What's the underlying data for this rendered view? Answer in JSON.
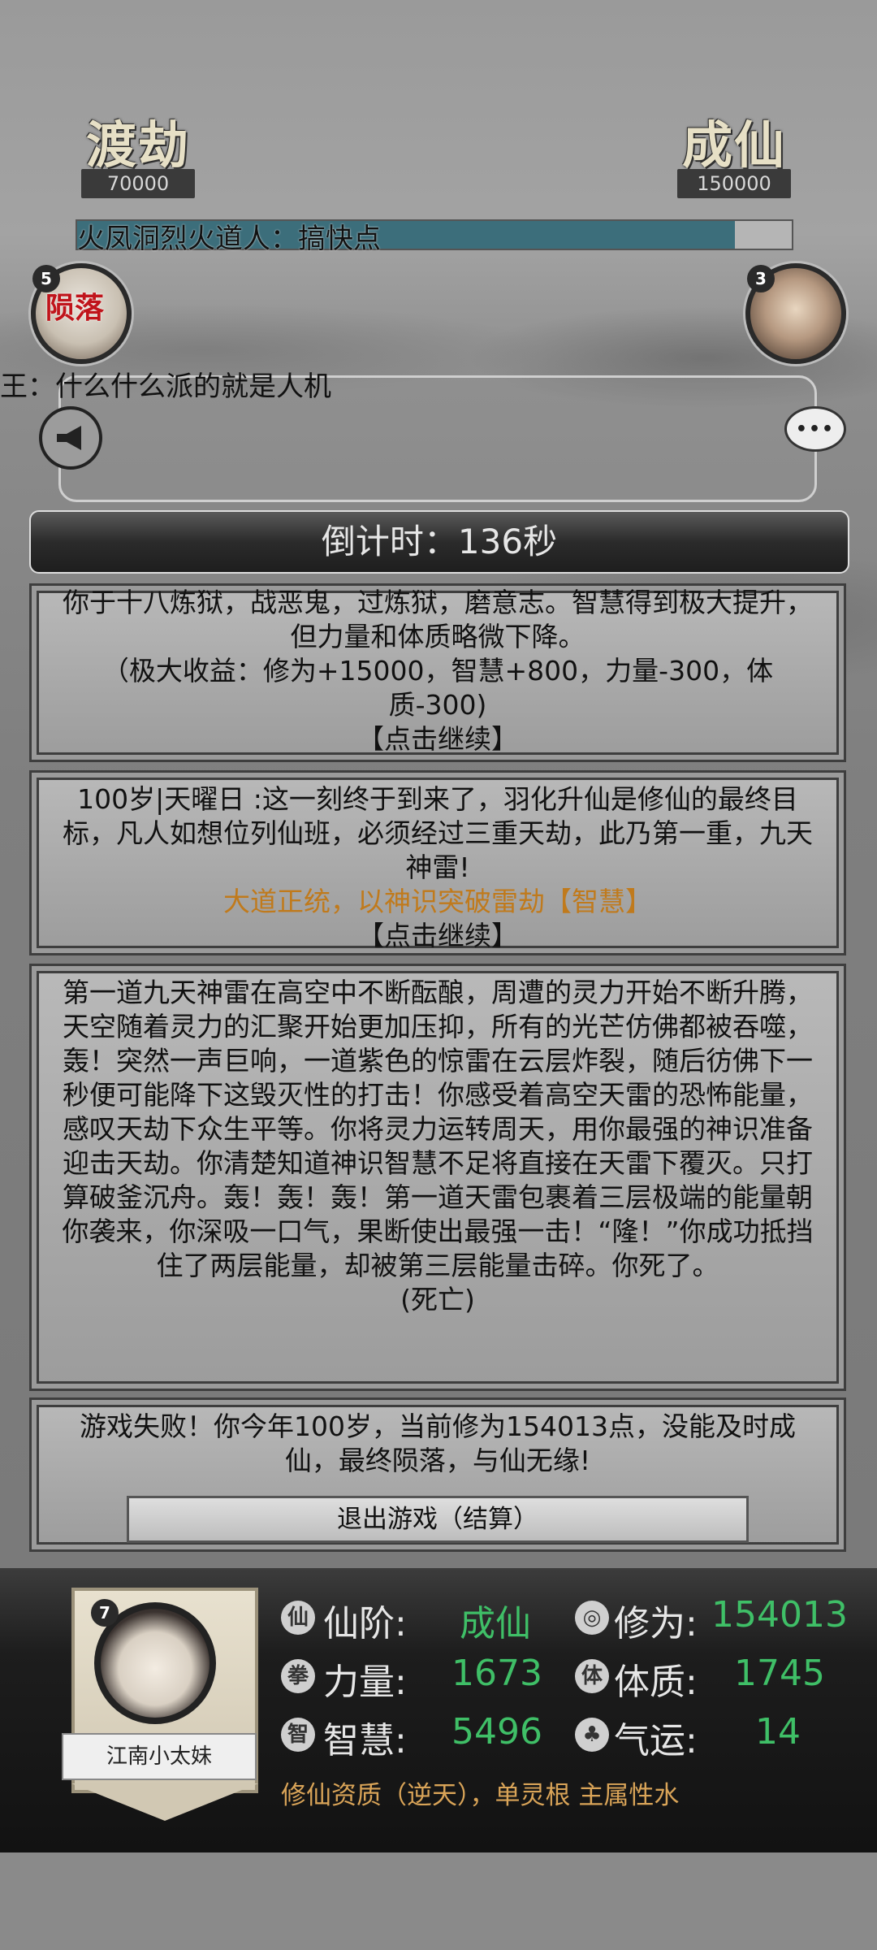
{
  "stages": {
    "left": {
      "name": "渡劫",
      "value": "70000"
    },
    "right": {
      "name": "成仙",
      "value": "150000"
    }
  },
  "progress": {
    "label": "火凤洞烈火道人：搞快点",
    "fraction": 0.92
  },
  "players": {
    "left": {
      "badge": "5",
      "status": "陨落"
    },
    "right": {
      "badge": "3"
    }
  },
  "chat": {
    "line": "王：什么什么派的就是人机"
  },
  "timer": {
    "text": "倒计时：136秒"
  },
  "cards": [
    {
      "lines": [
        "你于十八炼狱，战恶鬼，过炼狱，磨意志。智慧得到极大提升，但力量和体质略微下降。",
        "（极大收益：修为+15000，智慧+800，力量-300，体质-300)"
      ],
      "continue": "【点击继续】"
    },
    {
      "lines": [
        "100岁|天曜日 :这一刻终于到来了，羽化升仙是修仙的最终目标，凡人如想位列仙班，必须经过三重天劫，此乃第一重，九天神雷!"
      ],
      "highlight": "大道正统，以神识突破雷劫【智慧】",
      "continue": "【点击继续】"
    },
    {
      "lines": [
        "第一道九天神雷在高空中不断酝酿，周遭的灵力开始不断升腾，天空随着灵力的汇聚开始更加压抑，所有的光芒仿佛都被吞噬，轰！突然一声巨响，一道紫色的惊雷在云层炸裂，随后彷佛下一秒便可能降下这毁灭性的打击！你感受着高空天雷的恐怖能量，感叹天劫下众生平等。你将灵力运转周天，用你最强的神识准备迎击天劫。你清楚知道神识智慧不足将直接在天雷下覆灭。只打算破釜沉舟。轰！轰！轰！第一道天雷包裹着三层极端的能量朝你袭来，你深吸一口气，果断使出最强一击！“隆！”你成功抵挡住了两层能量，却被第三层能量击碎。你死了。"
      ],
      "result": "(死亡)"
    },
    {
      "lines": [
        "游戏失败！你今年100岁，当前修为154013点，没能及时成仙，最终陨落，与仙无缘!"
      ],
      "button": "退出游戏（结算）"
    }
  ],
  "profile": {
    "badge": "7",
    "name": "江南小太妹",
    "stats": {
      "realm": {
        "label": "仙阶:",
        "value": "成仙"
      },
      "cultivation": {
        "label": "修为:",
        "value": "154013"
      },
      "strength": {
        "label": "力量:",
        "value": "1673"
      },
      "constitution": {
        "label": "体质:",
        "value": "1745"
      },
      "wisdom": {
        "label": "智慧:",
        "value": "5496"
      },
      "luck": {
        "label": "气运:",
        "value": "14"
      }
    },
    "aptitude": "修仙资质（逆天），单灵根 主属性水"
  },
  "colors": {
    "accent": "#3fbf67",
    "gold": "#c07a1c",
    "dead": "#c0141b",
    "bar": "#3c6e7b"
  }
}
